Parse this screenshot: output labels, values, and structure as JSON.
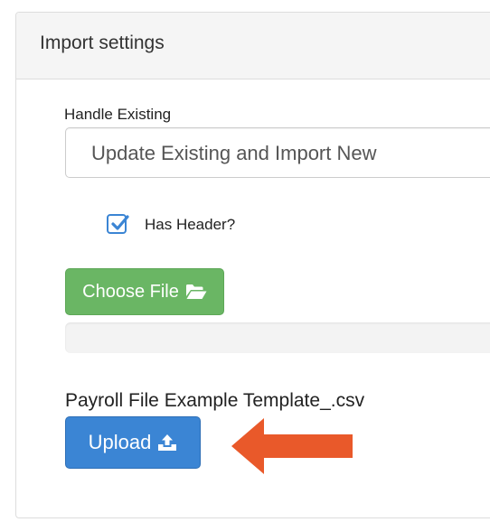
{
  "panel": {
    "title": "Import settings"
  },
  "handle_existing": {
    "label": "Handle Existing",
    "selected_value": "Update Existing and Import New"
  },
  "has_header": {
    "label": "Has Header?",
    "checked": true
  },
  "choose_file": {
    "label": "Choose File",
    "icon": "folder-open-icon"
  },
  "upload_progress": {
    "value": 0
  },
  "selected_file": {
    "name": "Payroll File Example Template_.csv"
  },
  "upload": {
    "label": "Upload",
    "icon": "upload-icon"
  },
  "colors": {
    "accent_blue": "#3b85d4",
    "success_green": "#6ab664",
    "annotation_orange": "#e9592a"
  }
}
